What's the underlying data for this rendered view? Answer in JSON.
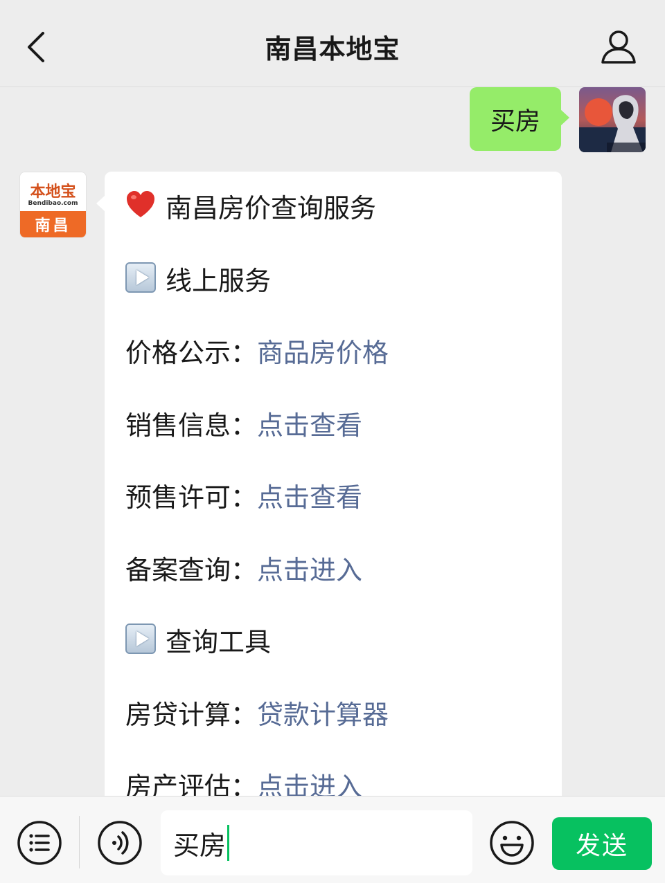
{
  "header": {
    "title": "南昌本地宝"
  },
  "user_message": {
    "text": "买房"
  },
  "bot": {
    "avatar": {
      "logo_text": "本地宝",
      "logo_sub": "Bendibao.com",
      "city": "南昌"
    },
    "message": {
      "title": "南昌房价查询服务",
      "section_online": "线上服务",
      "price_label": "价格公示：",
      "price_link": "商品房价格",
      "sales_label": "销售信息：",
      "sales_link": "点击查看",
      "presale_label": "预售许可：",
      "presale_link": "点击查看",
      "filing_label": "备案查询：",
      "filing_link": "点击进入",
      "section_tools": "查询工具",
      "loan_label": "房贷计算：",
      "loan_link": "贷款计算器",
      "appraisal_label": "房产评估：",
      "appraisal_link": "点击进入"
    }
  },
  "input_bar": {
    "value": "买房",
    "send_label": "发送"
  },
  "colors": {
    "user_bubble": "#95ec69",
    "link": "#576b95",
    "send_button": "#07c160",
    "background": "#ededed"
  },
  "icons": {
    "back": "chevron-left-icon",
    "profile": "person-icon",
    "menu": "list-icon",
    "voice": "voice-icon",
    "emoji": "smiley-icon",
    "heart": "heart-emoji",
    "play": "play-button-emoji"
  }
}
